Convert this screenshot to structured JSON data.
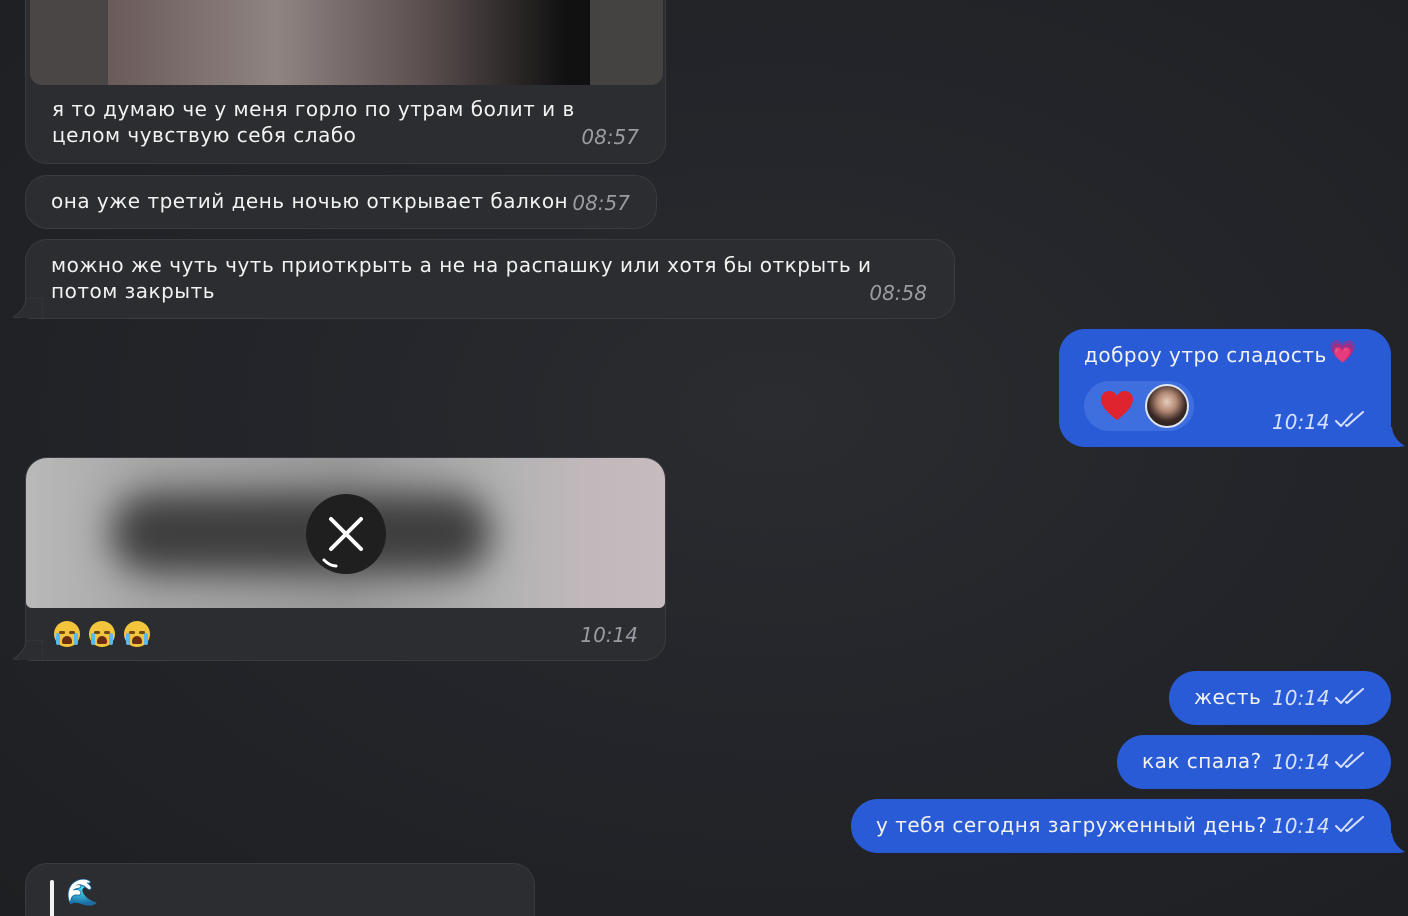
{
  "messages": [
    {
      "id": "m1",
      "side": "incoming",
      "text": "я то думаю че у меня горло по утрам болит и в целом чувствую себя слабо",
      "time": "08:57"
    },
    {
      "id": "m2",
      "side": "incoming",
      "text": "она уже третий день ночью открывает балкон",
      "time": "08:57"
    },
    {
      "id": "m3",
      "side": "incoming",
      "text": "можно же чуть чуть приоткрыть а не на распашку или хотя бы открыть и потом закрыть",
      "time": "08:58"
    },
    {
      "id": "m4",
      "side": "outgoing",
      "text": "доброу утро сладость",
      "emoji": "💗",
      "time": "10:14",
      "reactions": [
        "heart",
        "avatar"
      ]
    },
    {
      "id": "m5",
      "side": "incoming",
      "media": "video-blurred",
      "text": "😭😭😭",
      "time": "10:14"
    },
    {
      "id": "m6",
      "side": "outgoing",
      "text": "жесть",
      "time": "10:14"
    },
    {
      "id": "m7",
      "side": "outgoing",
      "text": "как спала?",
      "time": "10:14"
    },
    {
      "id": "m8",
      "side": "outgoing",
      "text": "у тебя сегодня загруженный день?",
      "time": "10:14"
    },
    {
      "id": "m9",
      "side": "incoming",
      "quote_emoji": "🌊"
    }
  ],
  "icons": {
    "read_ticks": "double-check-icon",
    "cancel_download": "close-icon",
    "reaction": "heart-icon"
  },
  "colors": {
    "incoming_bubble": "#2c2d30",
    "outgoing_bubble": "#2a5bd7",
    "background": "#202225"
  }
}
